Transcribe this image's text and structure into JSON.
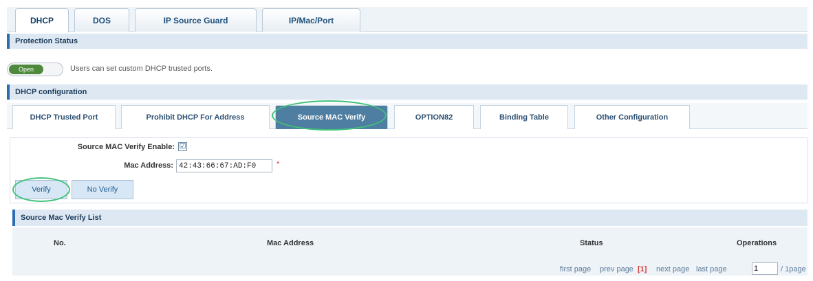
{
  "top_tabs": [
    {
      "label": "DHCP",
      "active": true
    },
    {
      "label": "DOS",
      "active": false
    },
    {
      "label": "IP Source Guard",
      "active": false
    },
    {
      "label": "IP/Mac/Port",
      "active": false
    }
  ],
  "protection": {
    "title": "Protection Status",
    "toggle_label": "Open",
    "description": "Users can set custom DHCP trusted ports."
  },
  "dhcp_config": {
    "title": "DHCP configuration",
    "sub_tabs": [
      {
        "label": "DHCP Trusted Port",
        "active": false
      },
      {
        "label": "Prohibit DHCP For Address",
        "active": false
      },
      {
        "label": "Source MAC Verify",
        "active": true
      },
      {
        "label": "OPTION82",
        "active": false
      },
      {
        "label": "Binding Table",
        "active": false
      },
      {
        "label": "Other Configuration",
        "active": false
      }
    ]
  },
  "form": {
    "enable_label": "Source MAC Verify Enable:",
    "enable_checked": "☑",
    "mac_label": "Mac Address:",
    "mac_value": "42:43:66:67:AD:F0",
    "required_mark": "*",
    "verify_button": "Verify",
    "no_verify_button": "No Verify"
  },
  "list": {
    "title": "Source Mac Verify List",
    "columns": [
      "No.",
      "Mac Address",
      "Status",
      "Operations"
    ],
    "pager": {
      "first": "first page",
      "prev": "prev page",
      "current": "[1]",
      "next": "next page",
      "last": "last page",
      "page_input": "1",
      "total": "/ 1page"
    }
  },
  "colors": {
    "accent": "#2a6db2",
    "active_tab": "#4e7ea1",
    "highlight": "#40c27a",
    "toggle_on": "#4f8a3c"
  }
}
